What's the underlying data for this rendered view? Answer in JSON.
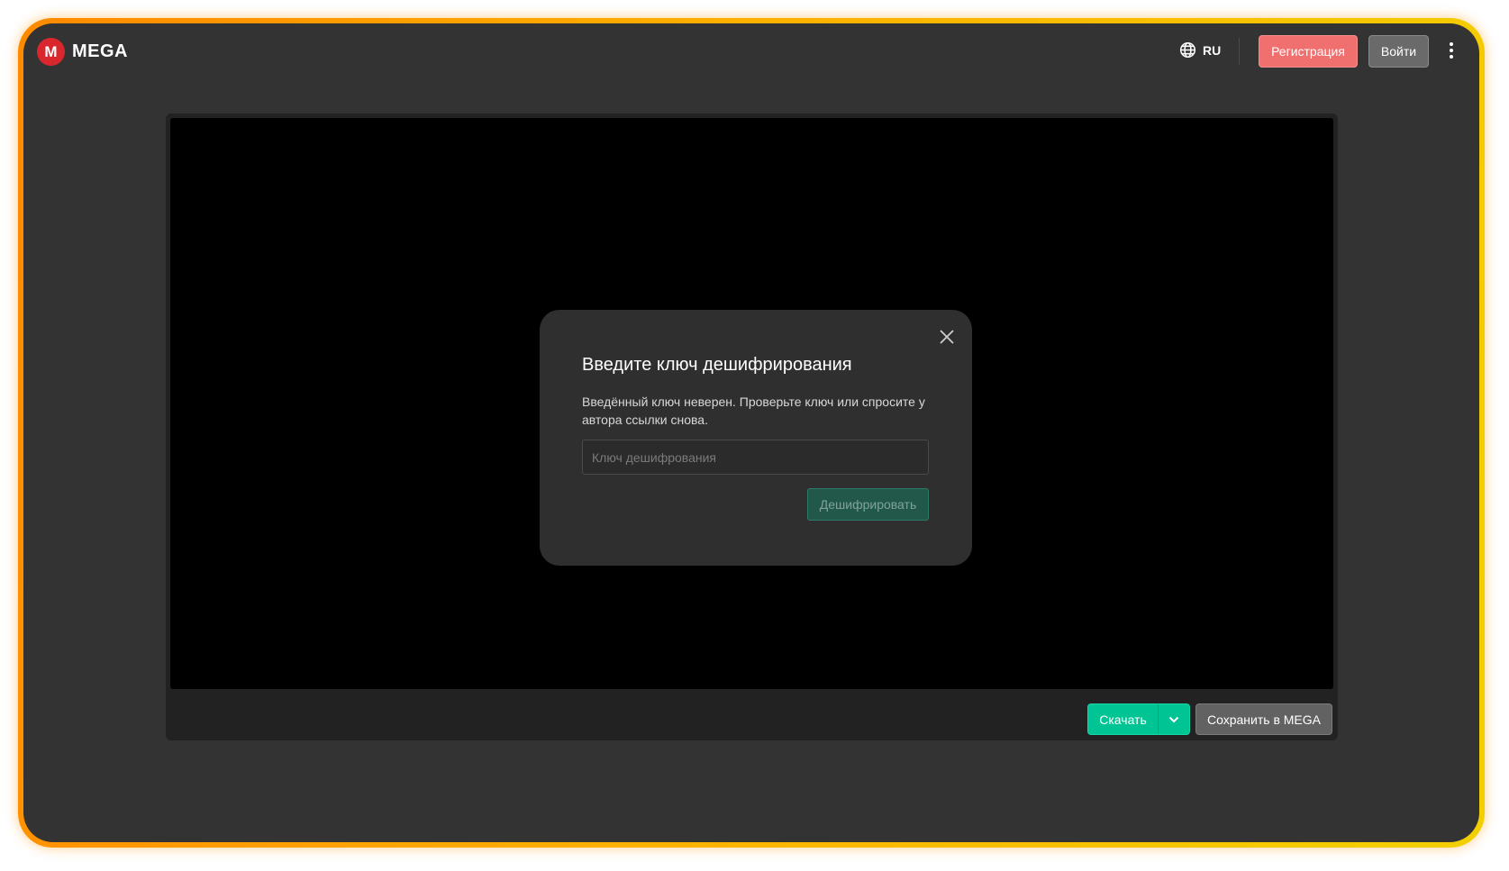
{
  "header": {
    "logo_mark": "M",
    "logo_text": "MEGA",
    "language": "RU",
    "register_label": "Регистрация",
    "login_label": "Войти"
  },
  "dialog": {
    "title": "Введите ключ дешифрирования",
    "message": "Введённый ключ неверен. Проверьте ключ или спросите у автора ссылки снова.",
    "input_placeholder": "Ключ дешифрования",
    "decrypt_label": "Дешифрировать"
  },
  "player_bar": {
    "download_label": "Скачать",
    "save_label": "Сохранить в MEGA"
  },
  "colors": {
    "brand": "#d9272e",
    "register": "#f0706f",
    "download": "#00c494",
    "frame_gradient_start": "#ff8a00",
    "frame_gradient_end": "#f2d000"
  }
}
